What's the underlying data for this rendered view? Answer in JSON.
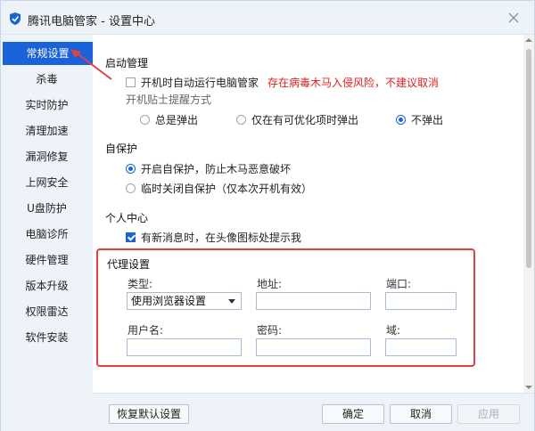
{
  "window": {
    "title": "腾讯电脑管家 - 设置中心"
  },
  "sidebar": {
    "items": [
      {
        "label": "常规设置",
        "active": true
      },
      {
        "label": "杀毒"
      },
      {
        "label": "实时防护"
      },
      {
        "label": "清理加速"
      },
      {
        "label": "漏洞修复"
      },
      {
        "label": "上网安全"
      },
      {
        "label": "U盘防护"
      },
      {
        "label": "电脑诊所"
      },
      {
        "label": "硬件管理"
      },
      {
        "label": "版本升级"
      },
      {
        "label": "权限雷达"
      },
      {
        "label": "软件安装"
      }
    ]
  },
  "startup": {
    "title": "启动管理",
    "autostart_label": "开机时自动运行电脑管家",
    "autostart_warning": "存在病毒木马入侵风险，不建议取消",
    "autostart_checked": false,
    "popup_title": "开机贴士提醒方式",
    "popup_options": [
      "总是弹出",
      "仅在有可优化项时弹出",
      "不弹出"
    ],
    "popup_selected": "不弹出"
  },
  "self_protect": {
    "title": "自保护",
    "options": [
      "开启自保护，防止木马恶意破坏",
      "临时关闭自保护（仅本次开机有效）"
    ],
    "selected": "开启自保护，防止木马恶意破坏"
  },
  "personal": {
    "title": "个人中心",
    "notify_label": "有新消息时，在头像图标处提示我",
    "notify_checked": true
  },
  "proxy": {
    "title": "代理设置",
    "type_label": "类型:",
    "type_value": "使用浏览器设置",
    "address_label": "地址:",
    "address_value": "",
    "port_label": "端口:",
    "port_value": "",
    "username_label": "用户名:",
    "username_value": "",
    "password_label": "密码:",
    "password_value": "",
    "domain_label": "域:",
    "domain_value": ""
  },
  "footer": {
    "restore_label": "恢复默认设置",
    "ok_label": "确定",
    "cancel_label": "取消",
    "apply_label": "应用"
  },
  "colors": {
    "accent": "#1a62d8",
    "warning": "#e02020",
    "highlight_box": "#e34040",
    "chrome_bg": "#eef3fa"
  },
  "icons": {
    "title_logo": "shield-logo-icon",
    "close": "close-icon",
    "dropdown": "chevron-down-icon"
  }
}
